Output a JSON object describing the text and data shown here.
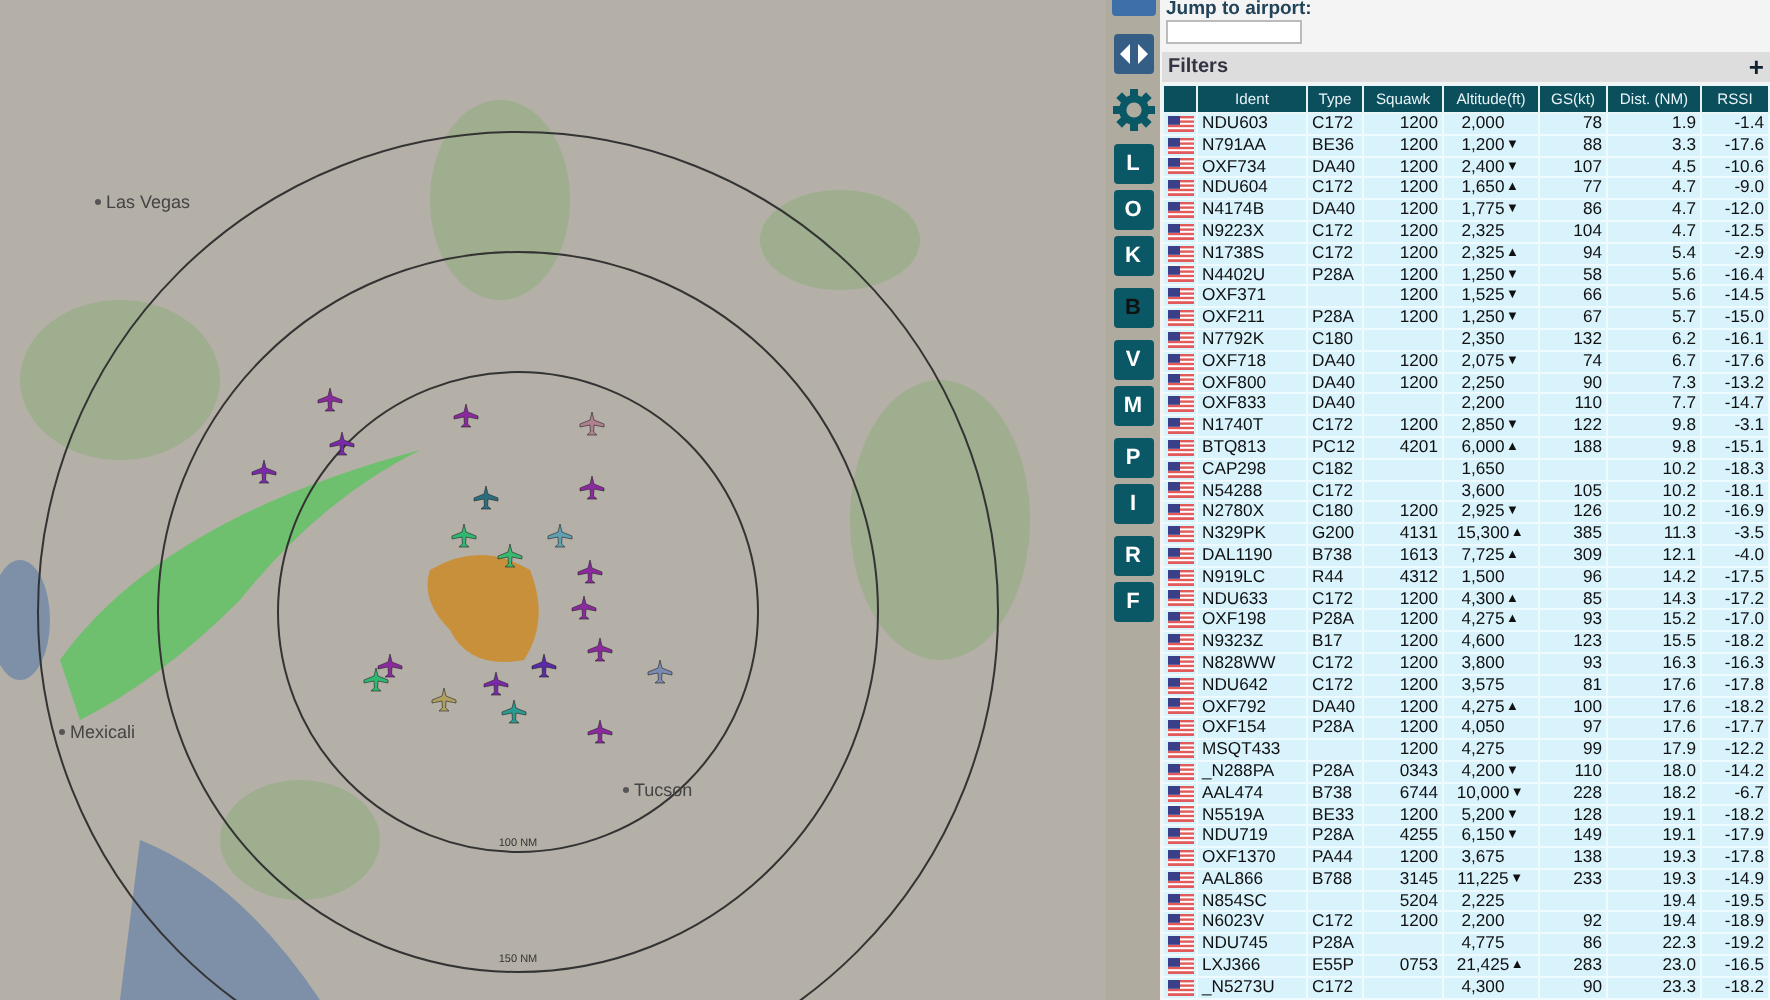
{
  "map": {
    "places": [
      {
        "name": "Las Vegas"
      },
      {
        "name": "Mexicali"
      },
      {
        "name": "Tucson"
      }
    ],
    "rings": [
      {
        "label": "100 NM"
      },
      {
        "label": "150 NM"
      }
    ]
  },
  "toolbar": {
    "buttons": [
      {
        "kind": "icon"
      },
      {
        "kind": "icon"
      },
      {
        "kind": "letter",
        "label": "L",
        "selected": false
      },
      {
        "kind": "letter",
        "label": "O",
        "selected": false
      },
      {
        "kind": "letter",
        "label": "K",
        "selected": false
      },
      {
        "kind": "letter",
        "label": "B",
        "selected": true
      },
      {
        "kind": "letter",
        "label": "V",
        "selected": false
      },
      {
        "kind": "letter",
        "label": "M",
        "selected": false
      },
      {
        "kind": "letter",
        "label": "P",
        "selected": false
      },
      {
        "kind": "letter",
        "label": "I",
        "selected": false
      },
      {
        "kind": "letter",
        "label": "R",
        "selected": false
      },
      {
        "kind": "letter",
        "label": "F",
        "selected": false
      }
    ]
  },
  "jump_to_airport": {
    "label": "Jump to airport:"
  },
  "filters": {
    "title": "Filters",
    "toggle": "+"
  },
  "table": {
    "columns": [
      "Ident",
      "Type",
      "Squawk",
      "Altitude(ft)",
      "GS(kt)",
      "Dist. (NM)",
      "RSSI"
    ],
    "rows": [
      {
        "ident": "NDU603",
        "type": "C172",
        "squawk": "1200",
        "altitude": "2,000",
        "trend": "",
        "gs": "78",
        "dist": "1.9",
        "rssi": "-1.4"
      },
      {
        "ident": "N791AA",
        "type": "BE36",
        "squawk": "1200",
        "altitude": "1,200",
        "trend": "▼",
        "gs": "88",
        "dist": "3.3",
        "rssi": "-17.6"
      },
      {
        "ident": "OXF734",
        "type": "DA40",
        "squawk": "1200",
        "altitude": "2,400",
        "trend": "▼",
        "gs": "107",
        "dist": "4.5",
        "rssi": "-10.6"
      },
      {
        "ident": "NDU604",
        "type": "C172",
        "squawk": "1200",
        "altitude": "1,650",
        "trend": "▲",
        "gs": "77",
        "dist": "4.7",
        "rssi": "-9.0"
      },
      {
        "ident": "N4174B",
        "type": "DA40",
        "squawk": "1200",
        "altitude": "1,775",
        "trend": "▼",
        "gs": "86",
        "dist": "4.7",
        "rssi": "-12.0"
      },
      {
        "ident": "N9223X",
        "type": "C172",
        "squawk": "1200",
        "altitude": "2,325",
        "trend": "",
        "gs": "104",
        "dist": "4.7",
        "rssi": "-12.5"
      },
      {
        "ident": "N1738S",
        "type": "C172",
        "squawk": "1200",
        "altitude": "2,325",
        "trend": "▲",
        "gs": "94",
        "dist": "5.4",
        "rssi": "-2.9"
      },
      {
        "ident": "N4402U",
        "type": "P28A",
        "squawk": "1200",
        "altitude": "1,250",
        "trend": "▼",
        "gs": "58",
        "dist": "5.6",
        "rssi": "-16.4"
      },
      {
        "ident": "OXF371",
        "type": "",
        "squawk": "1200",
        "altitude": "1,525",
        "trend": "▼",
        "gs": "66",
        "dist": "5.6",
        "rssi": "-14.5"
      },
      {
        "ident": "OXF211",
        "type": "P28A",
        "squawk": "1200",
        "altitude": "1,250",
        "trend": "▼",
        "gs": "67",
        "dist": "5.7",
        "rssi": "-15.0"
      },
      {
        "ident": "N7792K",
        "type": "C180",
        "squawk": "",
        "altitude": "2,350",
        "trend": "",
        "gs": "132",
        "dist": "6.2",
        "rssi": "-16.1"
      },
      {
        "ident": "OXF718",
        "type": "DA40",
        "squawk": "1200",
        "altitude": "2,075",
        "trend": "▼",
        "gs": "74",
        "dist": "6.7",
        "rssi": "-17.6"
      },
      {
        "ident": "OXF800",
        "type": "DA40",
        "squawk": "1200",
        "altitude": "2,250",
        "trend": "",
        "gs": "90",
        "dist": "7.3",
        "rssi": "-13.2"
      },
      {
        "ident": "OXF833",
        "type": "DA40",
        "squawk": "",
        "altitude": "2,200",
        "trend": "",
        "gs": "110",
        "dist": "7.7",
        "rssi": "-14.7"
      },
      {
        "ident": "N1740T",
        "type": "C172",
        "squawk": "1200",
        "altitude": "2,850",
        "trend": "▼",
        "gs": "122",
        "dist": "9.8",
        "rssi": "-3.1"
      },
      {
        "ident": "BTQ813",
        "type": "PC12",
        "squawk": "4201",
        "altitude": "6,000",
        "trend": "▲",
        "gs": "188",
        "dist": "9.8",
        "rssi": "-15.1"
      },
      {
        "ident": "CAP298",
        "type": "C182",
        "squawk": "",
        "altitude": "1,650",
        "trend": "",
        "gs": "",
        "dist": "10.2",
        "rssi": "-18.3"
      },
      {
        "ident": "N54288",
        "type": "C172",
        "squawk": "",
        "altitude": "3,600",
        "trend": "",
        "gs": "105",
        "dist": "10.2",
        "rssi": "-18.1"
      },
      {
        "ident": "N2780X",
        "type": "C180",
        "squawk": "1200",
        "altitude": "2,925",
        "trend": "▼",
        "gs": "126",
        "dist": "10.2",
        "rssi": "-16.9"
      },
      {
        "ident": "N329PK",
        "type": "G200",
        "squawk": "4131",
        "altitude": "15,300",
        "trend": "▲",
        "gs": "385",
        "dist": "11.3",
        "rssi": "-3.5"
      },
      {
        "ident": "DAL1190",
        "type": "B738",
        "squawk": "1613",
        "altitude": "7,725",
        "trend": "▲",
        "gs": "309",
        "dist": "12.1",
        "rssi": "-4.0"
      },
      {
        "ident": "N919LC",
        "type": "R44",
        "squawk": "4312",
        "altitude": "1,500",
        "trend": "",
        "gs": "96",
        "dist": "14.2",
        "rssi": "-17.5"
      },
      {
        "ident": "NDU633",
        "type": "C172",
        "squawk": "1200",
        "altitude": "4,300",
        "trend": "▲",
        "gs": "85",
        "dist": "14.3",
        "rssi": "-17.2"
      },
      {
        "ident": "OXF198",
        "type": "P28A",
        "squawk": "1200",
        "altitude": "4,275",
        "trend": "▲",
        "gs": "93",
        "dist": "15.2",
        "rssi": "-17.0"
      },
      {
        "ident": "N9323Z",
        "type": "B17",
        "squawk": "1200",
        "altitude": "4,600",
        "trend": "",
        "gs": "123",
        "dist": "15.5",
        "rssi": "-18.2"
      },
      {
        "ident": "N828WW",
        "type": "C172",
        "squawk": "1200",
        "altitude": "3,800",
        "trend": "",
        "gs": "93",
        "dist": "16.3",
        "rssi": "-16.3"
      },
      {
        "ident": "NDU642",
        "type": "C172",
        "squawk": "1200",
        "altitude": "3,575",
        "trend": "",
        "gs": "81",
        "dist": "17.6",
        "rssi": "-17.8"
      },
      {
        "ident": "OXF792",
        "type": "DA40",
        "squawk": "1200",
        "altitude": "4,275",
        "trend": "▲",
        "gs": "100",
        "dist": "17.6",
        "rssi": "-18.2"
      },
      {
        "ident": "OXF154",
        "type": "P28A",
        "squawk": "1200",
        "altitude": "4,050",
        "trend": "",
        "gs": "97",
        "dist": "17.6",
        "rssi": "-17.7"
      },
      {
        "ident": "MSQT433",
        "type": "",
        "squawk": "1200",
        "altitude": "4,275",
        "trend": "",
        "gs": "99",
        "dist": "17.9",
        "rssi": "-12.2"
      },
      {
        "ident": "_N288PA",
        "type": "P28A",
        "squawk": "0343",
        "altitude": "4,200",
        "trend": "▼",
        "gs": "110",
        "dist": "18.0",
        "rssi": "-14.2"
      },
      {
        "ident": "AAL474",
        "type": "B738",
        "squawk": "6744",
        "altitude": "10,000",
        "trend": "▼",
        "gs": "228",
        "dist": "18.2",
        "rssi": "-6.7"
      },
      {
        "ident": "N5519A",
        "type": "BE33",
        "squawk": "1200",
        "altitude": "5,200",
        "trend": "▼",
        "gs": "128",
        "dist": "19.1",
        "rssi": "-18.2"
      },
      {
        "ident": "NDU719",
        "type": "P28A",
        "squawk": "4255",
        "altitude": "6,150",
        "trend": "▼",
        "gs": "149",
        "dist": "19.1",
        "rssi": "-17.9"
      },
      {
        "ident": "OXF1370",
        "type": "PA44",
        "squawk": "1200",
        "altitude": "3,675",
        "trend": "",
        "gs": "138",
        "dist": "19.3",
        "rssi": "-17.8"
      },
      {
        "ident": "AAL866",
        "type": "B788",
        "squawk": "3145",
        "altitude": "11,225",
        "trend": "▼",
        "gs": "233",
        "dist": "19.3",
        "rssi": "-14.9"
      },
      {
        "ident": "N854SC",
        "type": "",
        "squawk": "5204",
        "altitude": "2,225",
        "trend": "",
        "gs": "",
        "dist": "19.4",
        "rssi": "-19.5"
      },
      {
        "ident": "N6023V",
        "type": "C172",
        "squawk": "1200",
        "altitude": "2,200",
        "trend": "",
        "gs": "92",
        "dist": "19.4",
        "rssi": "-18.9"
      },
      {
        "ident": "NDU745",
        "type": "P28A",
        "squawk": "",
        "altitude": "4,775",
        "trend": "",
        "gs": "86",
        "dist": "22.3",
        "rssi": "-19.2"
      },
      {
        "ident": "LXJ366",
        "type": "E55P",
        "squawk": "0753",
        "altitude": "21,425",
        "trend": "▲",
        "gs": "283",
        "dist": "23.0",
        "rssi": "-16.5"
      },
      {
        "ident": "_N5273U",
        "type": "C172",
        "squawk": "",
        "altitude": "4,300",
        "trend": "",
        "gs": "90",
        "dist": "23.3",
        "rssi": "-18.2"
      }
    ]
  }
}
